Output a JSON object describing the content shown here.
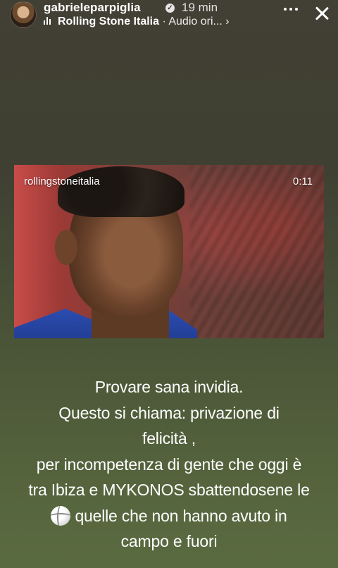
{
  "header": {
    "username": "gabrieleparpiglia",
    "time_ago": "19 min",
    "audio": {
      "artist": "Rolling Stone Italia",
      "separator": " · ",
      "label": "Audio ori... ›"
    },
    "icons": {
      "avatar": "avatar",
      "verified": "verified-badge-icon",
      "audio": "audio-bars-icon",
      "more": "more-options-icon",
      "close": "close-icon"
    }
  },
  "video": {
    "handle": "rollingstoneitalia",
    "duration": "0:11"
  },
  "caption": {
    "lines": [
      "Provare sana invidia.",
      "Questo si chiama: privazione di",
      "felicità ,",
      "per incompetenza di gente che oggi è",
      "tra Ibiza e MYKONOS sbattendosene le",
      "quelle che non hanno avuto in",
      "campo e fuori"
    ],
    "emoji": "volleyball"
  }
}
